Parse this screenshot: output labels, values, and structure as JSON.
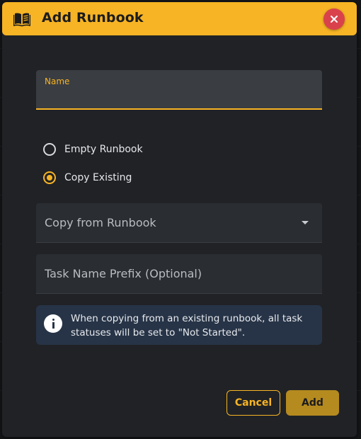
{
  "dialog": {
    "title": "Add Runbook",
    "header_icon": "book-open-icon",
    "close_icon": "close-icon"
  },
  "form": {
    "name_label": "Name",
    "name_value": "",
    "radio_options": [
      {
        "label": "Empty Runbook",
        "selected": false
      },
      {
        "label": "Copy Existing",
        "selected": true
      }
    ],
    "copy_from_placeholder": "Copy from Runbook",
    "prefix_placeholder": "Task Name Prefix (Optional)",
    "prefix_value": ""
  },
  "info": {
    "icon": "info-icon",
    "text": "When copying from an existing runbook, all task statuses will be set to \"Not Started\"."
  },
  "actions": {
    "cancel_label": "Cancel",
    "add_label": "Add"
  },
  "colors": {
    "accent": "#f7b424",
    "dialog_bg": "#202226",
    "info_bg": "#273447",
    "close": "#d9424b"
  }
}
